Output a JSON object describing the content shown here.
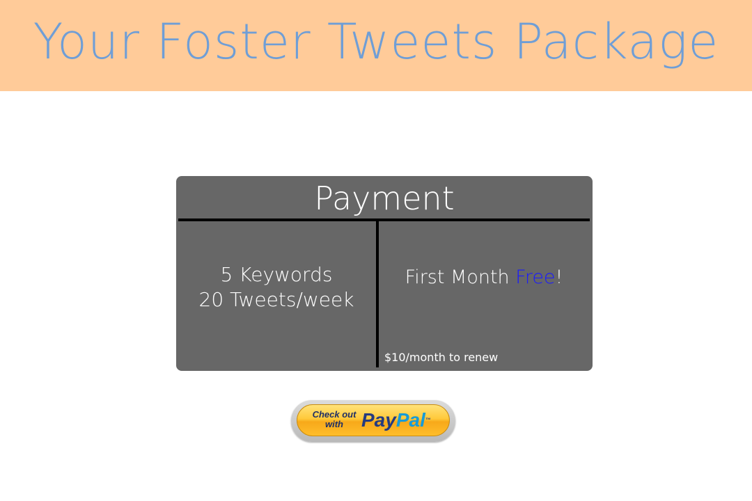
{
  "header": {
    "title": "Your Foster Tweets Package",
    "background_color": "#ffcb99",
    "title_color": "#6f9ed6"
  },
  "card": {
    "title": "Payment",
    "background_color": "#676767",
    "left": {
      "line1": "5 Keywords",
      "line2": "20 Tweets/week"
    },
    "right": {
      "offer_prefix": "First Month ",
      "offer_highlight": "Free",
      "offer_suffix": "!",
      "highlight_color": "#1a1aff",
      "renew_text": "$10/month to renew"
    }
  },
  "paypal_button": {
    "checkout_line1": "Check out",
    "checkout_line2": "with",
    "logo_pay": "Pay",
    "logo_pal": "Pal",
    "trademark": "™",
    "icon": "paypal-logo"
  }
}
